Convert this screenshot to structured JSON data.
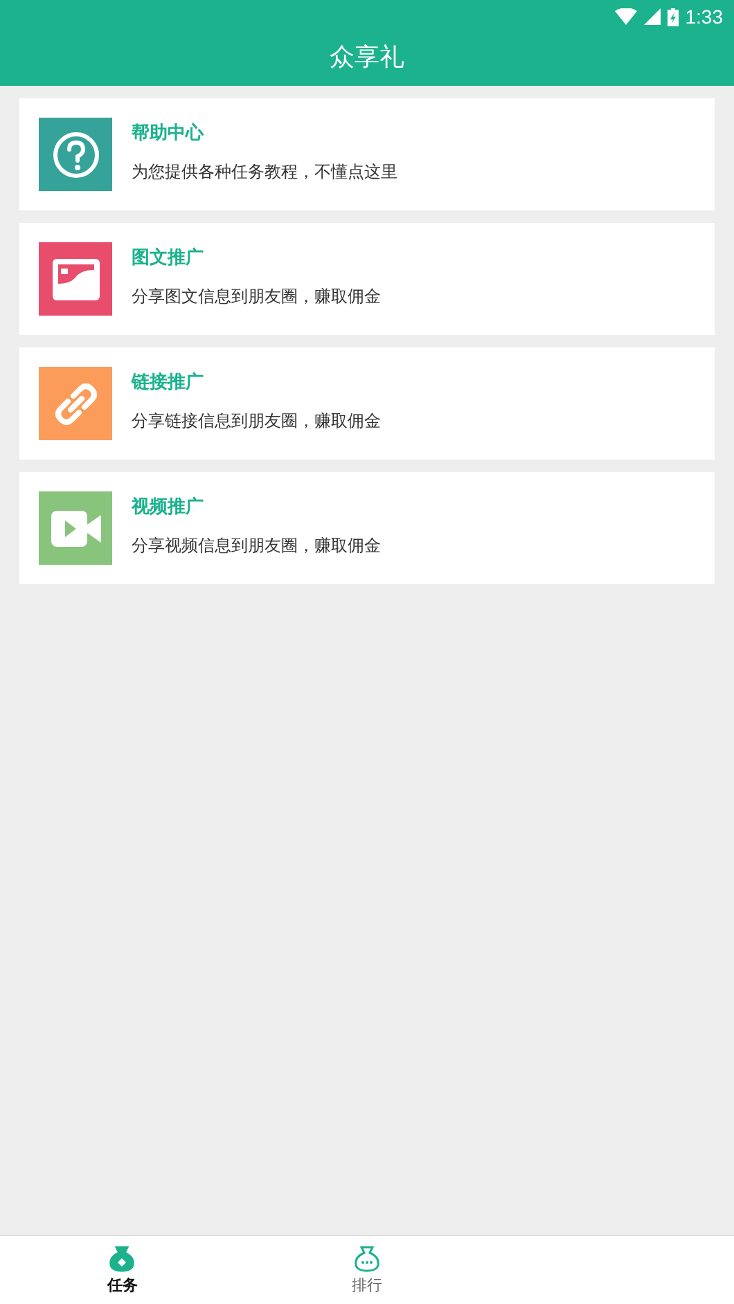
{
  "status_bar": {
    "time": "1:33"
  },
  "header": {
    "title": "众享礼"
  },
  "items": [
    {
      "kind": "help",
      "color": "#35a39a",
      "title": "帮助中心",
      "subtitle": "为您提供各种任务教程，不懂点这里"
    },
    {
      "kind": "image",
      "color": "#e84d6c",
      "title": "图文推广",
      "subtitle": "分享图文信息到朋友圈，赚取佣金"
    },
    {
      "kind": "link",
      "color": "#fc9c5a",
      "title": "链接推广",
      "subtitle": "分享链接信息到朋友圈，赚取佣金"
    },
    {
      "kind": "video",
      "color": "#88c47c",
      "title": "视频推广",
      "subtitle": "分享视频信息到朋友圈，赚取佣金"
    }
  ],
  "tabs": [
    {
      "label": "任务",
      "selected": true
    },
    {
      "label": "排行",
      "selected": false
    }
  ]
}
